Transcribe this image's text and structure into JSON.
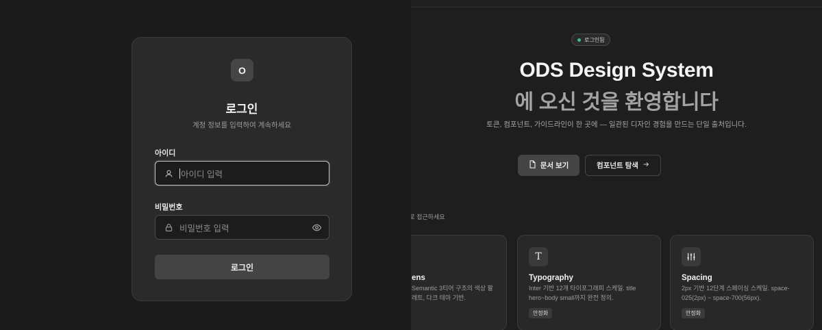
{
  "login": {
    "logo_letter": "O",
    "title": "로그인",
    "subtitle": "계정 정보를 입력하여 계속하세요",
    "id_label": "아이디",
    "id_placeholder": "아이디 입력",
    "pw_label": "비밀번호",
    "pw_placeholder": "비밀번호 입력",
    "submit_label": "로그인"
  },
  "landing": {
    "badge": "로그인됨",
    "title_line1": "ODS Design System",
    "title_line2": "에 오신 것을 환영합니다",
    "description": "토큰, 컴포넌트, 가이드라인이 한 곳에 — 일관된 디자인 경험을 만드는 단일 출처입니다.",
    "docs_button": "문서 보기",
    "components_button": "컴포넌트 탐색",
    "section_label": "스에 바로 접근하세요",
    "cards": [
      {
        "icon": "palette-icon",
        "title": "ens",
        "description": "Semantic 3티어 구조의 색상 팔레트, 다크 테마 기반.",
        "tag": ""
      },
      {
        "icon": "typography-icon",
        "icon_glyph": "T",
        "title": "Typography",
        "description": "Inter 기반 12개 타이포그래피 스케일. title hero~body small까지 완전 정의.",
        "tag": "안정화"
      },
      {
        "icon": "sliders-icon",
        "title": "Spacing",
        "description": "2px 기반 12단계 스페이싱 스케일. space-025(2px) ~ space-700(56px).",
        "tag": "안정화"
      }
    ]
  },
  "colors": {
    "badge_dot": "#3fbf7f",
    "accent_button": "#444444",
    "background": "#1b1b1b"
  }
}
